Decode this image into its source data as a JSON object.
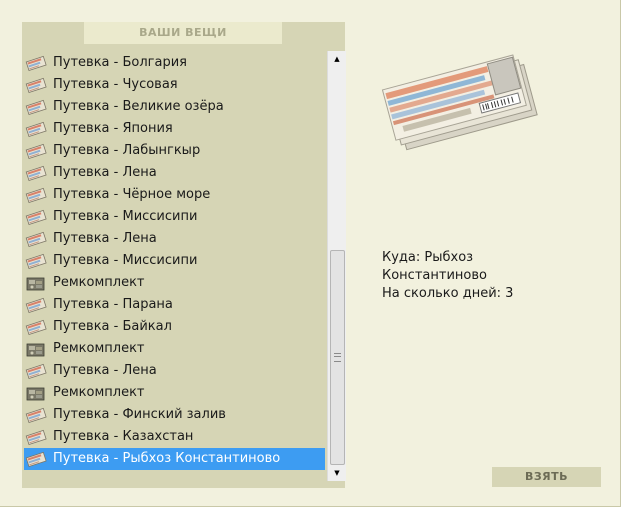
{
  "panel": {
    "title": "ВАШИ ВЕЩИ"
  },
  "items": [
    {
      "label": "Путевка - Болгария",
      "icon": "voucher-icon"
    },
    {
      "label": "Путевка - Чусовая",
      "icon": "voucher-icon"
    },
    {
      "label": "Путевка - Великие озёра",
      "icon": "voucher-icon"
    },
    {
      "label": "Путевка - Япония",
      "icon": "voucher-icon"
    },
    {
      "label": "Путевка - Лабынгкыр",
      "icon": "voucher-icon"
    },
    {
      "label": "Путевка - Лена",
      "icon": "voucher-icon"
    },
    {
      "label": "Путевка - Чёрное море",
      "icon": "voucher-icon"
    },
    {
      "label": "Путевка - Миссисипи",
      "icon": "voucher-icon"
    },
    {
      "label": "Путевка - Лена",
      "icon": "voucher-icon"
    },
    {
      "label": "Путевка - Миссисипи",
      "icon": "voucher-icon"
    },
    {
      "label": "Ремкомплект",
      "icon": "repair-kit-icon"
    },
    {
      "label": "Путевка - Парана",
      "icon": "voucher-icon"
    },
    {
      "label": "Путевка - Байкал",
      "icon": "voucher-icon"
    },
    {
      "label": "Ремкомплект",
      "icon": "repair-kit-icon"
    },
    {
      "label": "Путевка - Лена",
      "icon": "voucher-icon"
    },
    {
      "label": "Ремкомплект",
      "icon": "repair-kit-icon"
    },
    {
      "label": "Путевка - Финский залив",
      "icon": "voucher-icon"
    },
    {
      "label": "Путевка - Казахстан",
      "icon": "voucher-icon"
    },
    {
      "label": "Путевка - Рыбхоз Константиново",
      "icon": "voucher-icon",
      "selected": true
    }
  ],
  "details": {
    "line1": "Куда: Рыбхоз",
    "line2": "Константиново",
    "line3": "На сколько дней: 3"
  },
  "preview": {
    "icon": "voucher-tickets-image"
  },
  "colors": {
    "selection": "#3d9cf2",
    "panel": "#d6d5b5",
    "background": "#f2f1de"
  },
  "take_button": {
    "label": "ВЗЯТЬ"
  }
}
